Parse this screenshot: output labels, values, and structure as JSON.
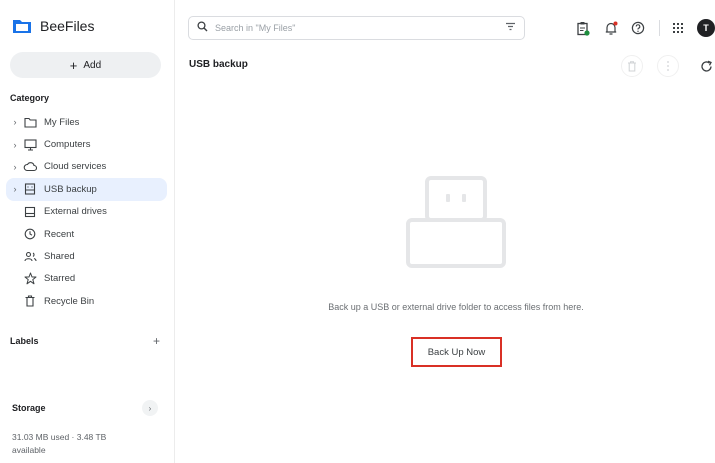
{
  "app": {
    "name": "BeeFiles",
    "brand_color": "#1a73e8"
  },
  "sidebar": {
    "add_label": "Add",
    "category_label": "Category",
    "items": [
      {
        "label": "My Files",
        "icon": "folder-icon",
        "expandable": true,
        "active": false
      },
      {
        "label": "Computers",
        "icon": "computer-icon",
        "expandable": true,
        "active": false
      },
      {
        "label": "Cloud services",
        "icon": "cloud-icon",
        "expandable": true,
        "active": false
      },
      {
        "label": "USB backup",
        "icon": "usb-drive-icon",
        "expandable": true,
        "active": true
      },
      {
        "label": "External drives",
        "icon": "external-drive-icon",
        "expandable": false,
        "active": false
      },
      {
        "label": "Recent",
        "icon": "clock-icon",
        "expandable": false,
        "active": false
      },
      {
        "label": "Shared",
        "icon": "people-icon",
        "expandable": false,
        "active": false
      },
      {
        "label": "Starred",
        "icon": "star-icon",
        "expandable": false,
        "active": false
      },
      {
        "label": "Recycle Bin",
        "icon": "trash-icon",
        "expandable": false,
        "active": false
      }
    ],
    "labels_label": "Labels",
    "storage_label": "Storage",
    "storage_text": "31.03 MB used · 3.48 TB available"
  },
  "search": {
    "placeholder": "Search in \"My Files\"",
    "value": ""
  },
  "topbar": {
    "icons": [
      "clipboard-task-icon",
      "bell-icon",
      "help-icon",
      "apps-grid-icon"
    ],
    "avatar_initial": "T",
    "notification_color": "#d93025",
    "task_badge_color": "#1e8e3e"
  },
  "main": {
    "title": "USB backup",
    "empty_message": "Back up a USB or external drive folder to access files from here.",
    "backup_button": "Back Up Now",
    "highlight_color": "#d93025"
  }
}
